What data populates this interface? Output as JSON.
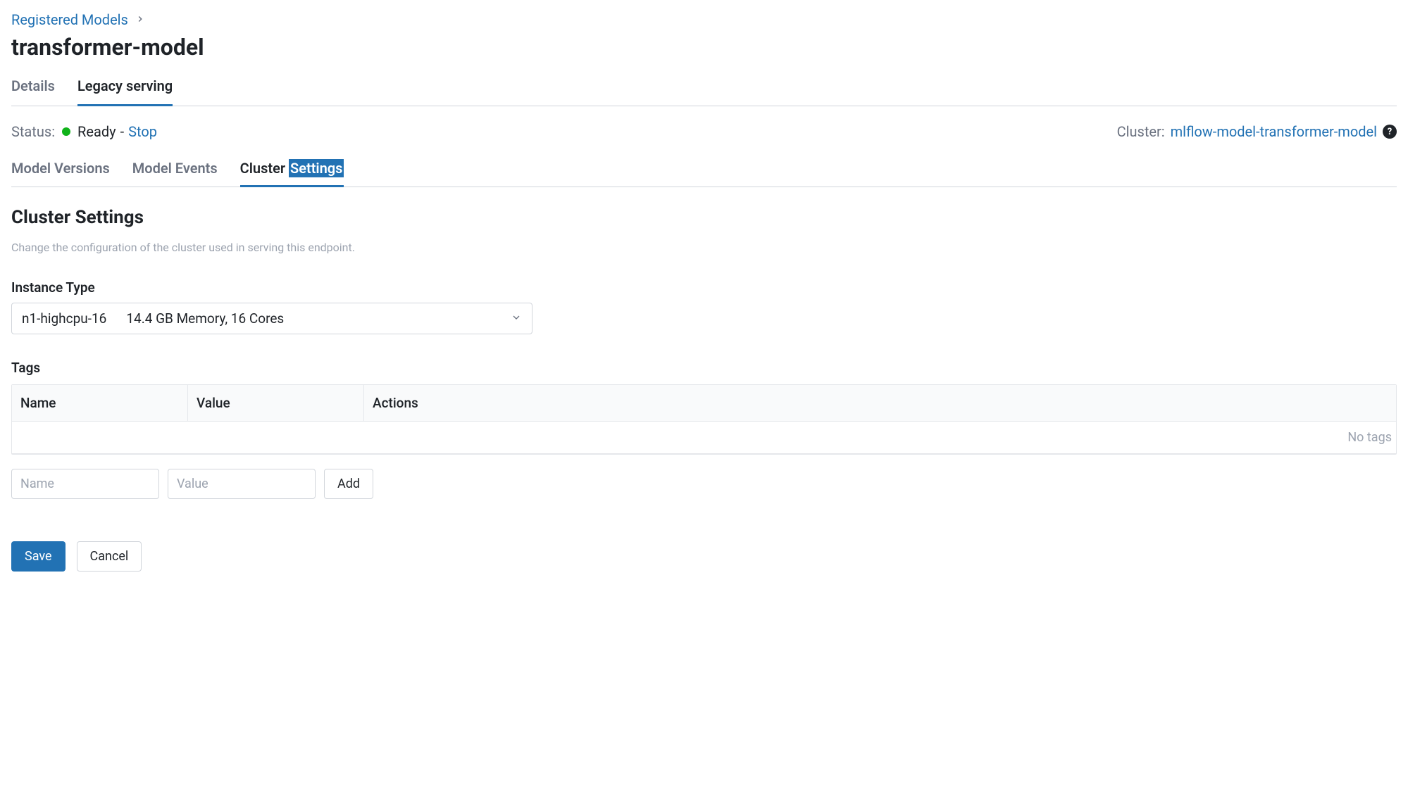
{
  "breadcrumb": {
    "parent": "Registered Models"
  },
  "page_title": "transformer-model",
  "tabs_top": {
    "details": "Details",
    "legacy_serving": "Legacy serving"
  },
  "status": {
    "label": "Status:",
    "value": "Ready",
    "separator": " - ",
    "stop": "Stop"
  },
  "cluster": {
    "label": "Cluster:",
    "name": "mlflow-model-transformer-model"
  },
  "tabs_sub": {
    "model_versions": "Model Versions",
    "model_events": "Model Events",
    "cluster_settings_prefix": "Cluster ",
    "cluster_settings_highlight": "Settings"
  },
  "section": {
    "title": "Cluster Settings",
    "description": "Change the configuration of the cluster used in serving this endpoint."
  },
  "instance_type": {
    "label": "Instance Type",
    "selected_name": "n1-highcpu-16",
    "selected_description": "14.4 GB Memory, 16 Cores"
  },
  "tags": {
    "label": "Tags",
    "columns": {
      "name": "Name",
      "value": "Value",
      "actions": "Actions"
    },
    "empty": "No tags",
    "name_placeholder": "Name",
    "value_placeholder": "Value",
    "add_button": "Add"
  },
  "buttons": {
    "save": "Save",
    "cancel": "Cancel"
  }
}
